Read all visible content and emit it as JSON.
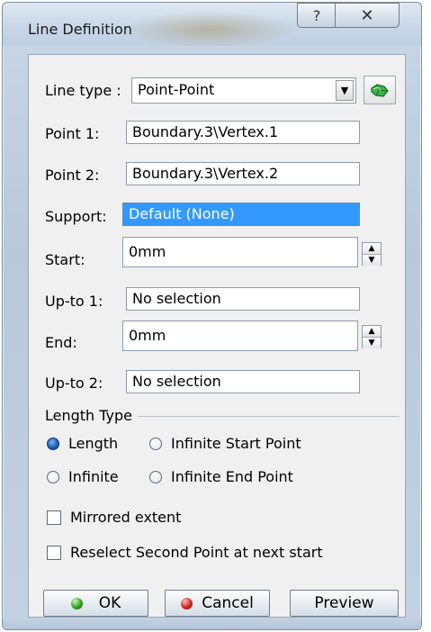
{
  "window": {
    "title": "Line Definition"
  },
  "titlebar": {
    "help_glyph": "?",
    "close_glyph": "✕"
  },
  "line_type": {
    "label": "Line type :",
    "value": "Point-Point",
    "arrow_glyph": "▼"
  },
  "fields": {
    "point1": {
      "label": "Point 1:",
      "value": "Boundary.3\\Vertex.1"
    },
    "point2": {
      "label": "Point 2:",
      "value": "Boundary.3\\Vertex.2"
    },
    "support": {
      "label": "Support:",
      "value": "Default (None)"
    },
    "start": {
      "label": "Start:",
      "value": "0mm"
    },
    "upto1": {
      "label": "Up-to 1:",
      "value": "No selection"
    },
    "end": {
      "label": "End:",
      "value": "0mm"
    },
    "upto2": {
      "label": "Up-to 2:",
      "value": "No selection"
    }
  },
  "length_type": {
    "label": "Length Type",
    "options": [
      {
        "label": "Length",
        "selected": true
      },
      {
        "label": "Infinite Start Point",
        "selected": false
      },
      {
        "label": "Infinite",
        "selected": false
      },
      {
        "label": "Infinite End Point",
        "selected": false
      }
    ]
  },
  "checkboxes": {
    "mirrored": {
      "label": "Mirrored extent",
      "checked": false
    },
    "reselect": {
      "label": "Reselect Second Point at next start",
      "checked": false
    }
  },
  "buttons": {
    "ok": "OK",
    "cancel": "Cancel",
    "preview": "Preview"
  },
  "spin_glyphs": {
    "up": "▲",
    "down": "▼"
  },
  "colors": {
    "selection": "#3399ff",
    "ok_icon": "#2fa11e",
    "cancel_icon": "#d02424",
    "radio_on": "#1f5fb8"
  }
}
